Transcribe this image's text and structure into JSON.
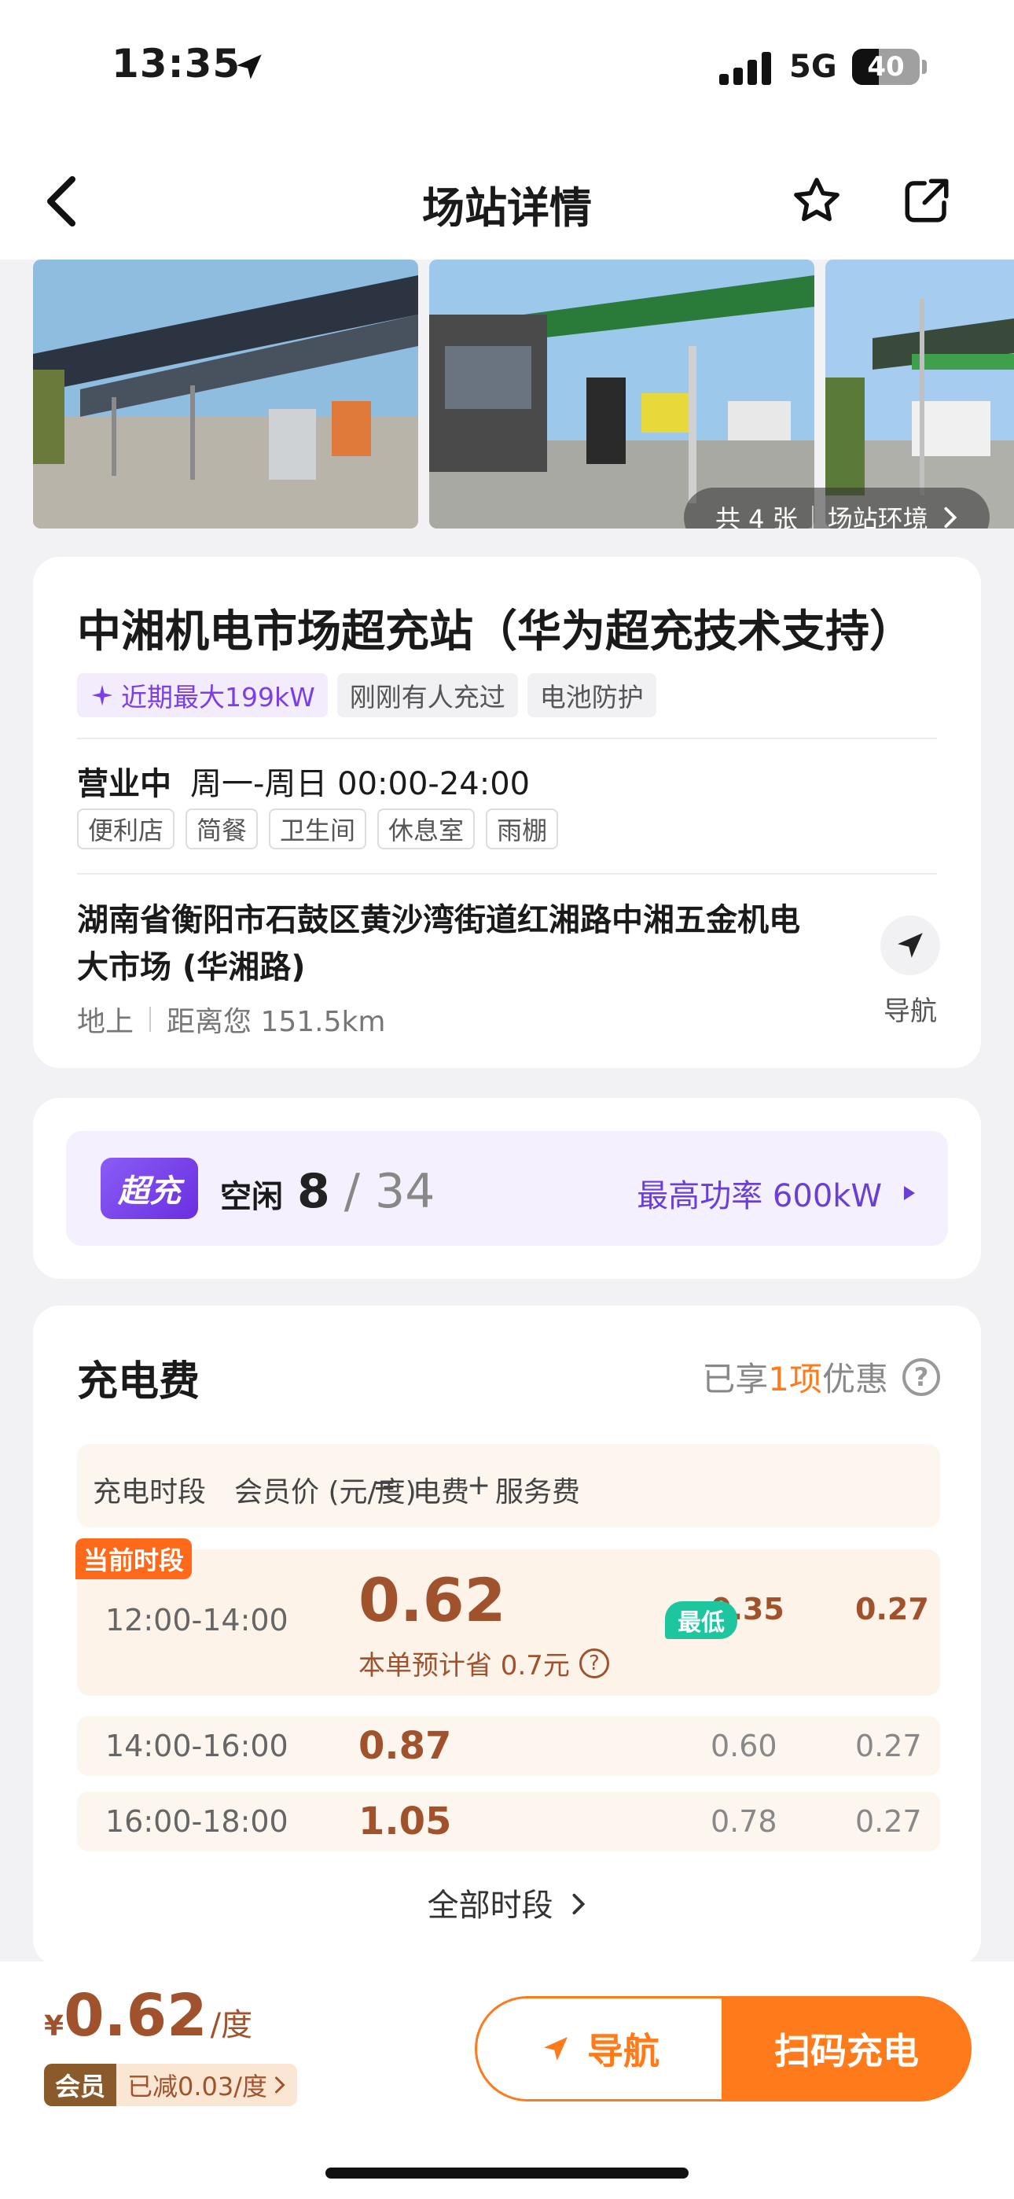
{
  "status_bar": {
    "time": "13:35",
    "network": "5G",
    "battery": "40",
    "battery_level": 0.4
  },
  "nav": {
    "title": "场站详情",
    "icons": [
      "back-icon",
      "star-icon",
      "share-icon"
    ]
  },
  "photos": {
    "count_label": "共 4 张",
    "env_label": "场站环境"
  },
  "station": {
    "name": "中湘机电市场超充站（华为超充技术支持）",
    "tags": [
      "近期最大199kW",
      "刚刚有人充过",
      "电池防护"
    ],
    "status": "营业中",
    "hours": "周一-周日 00:00-24:00",
    "amenities": [
      "便利店",
      "简餐",
      "卫生间",
      "休息室",
      "雨棚"
    ],
    "address_line1": "湖南省衡阳市石鼓区黄沙湾街道红湘路中湘五金机电",
    "address_line2": "大市场 (华湘路)",
    "floor": "地上",
    "distance": "距离您 151.5km",
    "nav_label": "导航"
  },
  "charger": {
    "badge": "超充",
    "idle_label": "空闲",
    "idle": "8",
    "total": "/ 34",
    "max_power": "最高功率 600kW"
  },
  "fee": {
    "title": "充电费",
    "discount_prefix": "已享",
    "discount_count": "1项",
    "discount_suffix": "优惠",
    "headers": {
      "period": "充电时段",
      "member_price": "会员价 (元/度)",
      "eq": "=",
      "elec": "电费",
      "plus": "+",
      "service": "服务费"
    },
    "current_label": "当前时段",
    "lowest_label": "最低",
    "current": {
      "period": "12:00-14:00",
      "price": "0.62",
      "elec": "0.35",
      "service": "0.27",
      "note": "本单预计省 0.7元"
    },
    "rows": [
      {
        "period": "14:00-16:00",
        "price": "0.87",
        "elec": "0.60",
        "service": "0.27"
      },
      {
        "period": "16:00-18:00",
        "price": "1.05",
        "elec": "0.78",
        "service": "0.27"
      }
    ],
    "all_periods": "全部时段"
  },
  "bottom": {
    "currency": "¥",
    "price": "0.62",
    "unit": "/度",
    "member_badge": "会员",
    "member_discount": "已减0.03/度",
    "nav_button": "导航",
    "scan_button": "扫码充电"
  },
  "colors": {
    "accent": "#ff7a1a",
    "price": "#a0522d",
    "purple": "#6a3fd6",
    "lowest": "#1ec6a0"
  }
}
